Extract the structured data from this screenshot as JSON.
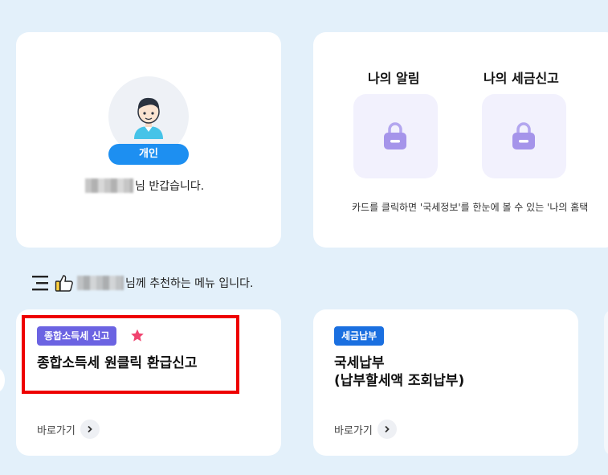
{
  "profile": {
    "user_type": "개인",
    "greeting_suffix": "님 반갑습니다."
  },
  "info": {
    "my_notice_label": "나의 알림",
    "my_tax_report_label": "나의 세금신고",
    "note": "카드를 클릭하면 '국세정보'를 한눈에 볼 수 있는 '나의 홈택"
  },
  "recommend": {
    "text": "님께 추천하는 메뉴 입니다."
  },
  "menus": [
    {
      "tag": "종합소득세 신고",
      "title_line1": "종합소득세 원클릭 환급신고",
      "title_line2": "",
      "goto_label": "바로가기"
    },
    {
      "tag": "세금납부",
      "title_line1": "국세납부",
      "title_line2": "(납부할세액 조회납부)",
      "goto_label": "바로가기"
    }
  ],
  "colors": {
    "background": "#e3f0fa",
    "accent_blue": "#1d8ff1",
    "tag_purple": "#6b63e2",
    "tag_blue": "#1a6fe0",
    "star": "#f0446f",
    "highlight": "#ee0000"
  }
}
